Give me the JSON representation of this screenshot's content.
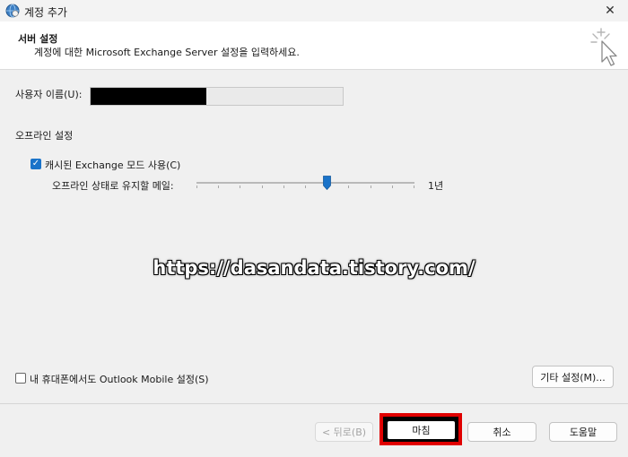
{
  "window": {
    "title": "계정 추가",
    "close_glyph": "✕"
  },
  "header": {
    "title": "서버 설정",
    "description": "계정에 대한 Microsoft Exchange Server 설정을 입력하세요."
  },
  "form": {
    "user_label": "사용자 이름(U):",
    "offline_title": "오프라인 설정",
    "cache_mode": {
      "label": "캐시된 Exchange 모드 사용(C)",
      "checked": true
    },
    "offline_keep": {
      "label": "오프라인 상태로 유지할 메일:",
      "value_label": "1년",
      "position": 0.6
    },
    "mobile": {
      "label": "내 휴대폰에서도 Outlook Mobile 설정(S)",
      "checked": false
    },
    "more_settings_label": "기타 설정(M)..."
  },
  "watermark": "https://dasandata.tistory.com/",
  "footer": {
    "back_label": "< 뒤로(B)",
    "finish_label": "마침",
    "cancel_label": "취소",
    "help_label": "도움말"
  },
  "icons": {
    "app": "globe-icon",
    "wizard": "cursor-sparkle-icon",
    "close": "close-icon",
    "check": "checkmark-icon"
  },
  "colors": {
    "accent": "#1a73c9",
    "highlight": "#e00000"
  }
}
